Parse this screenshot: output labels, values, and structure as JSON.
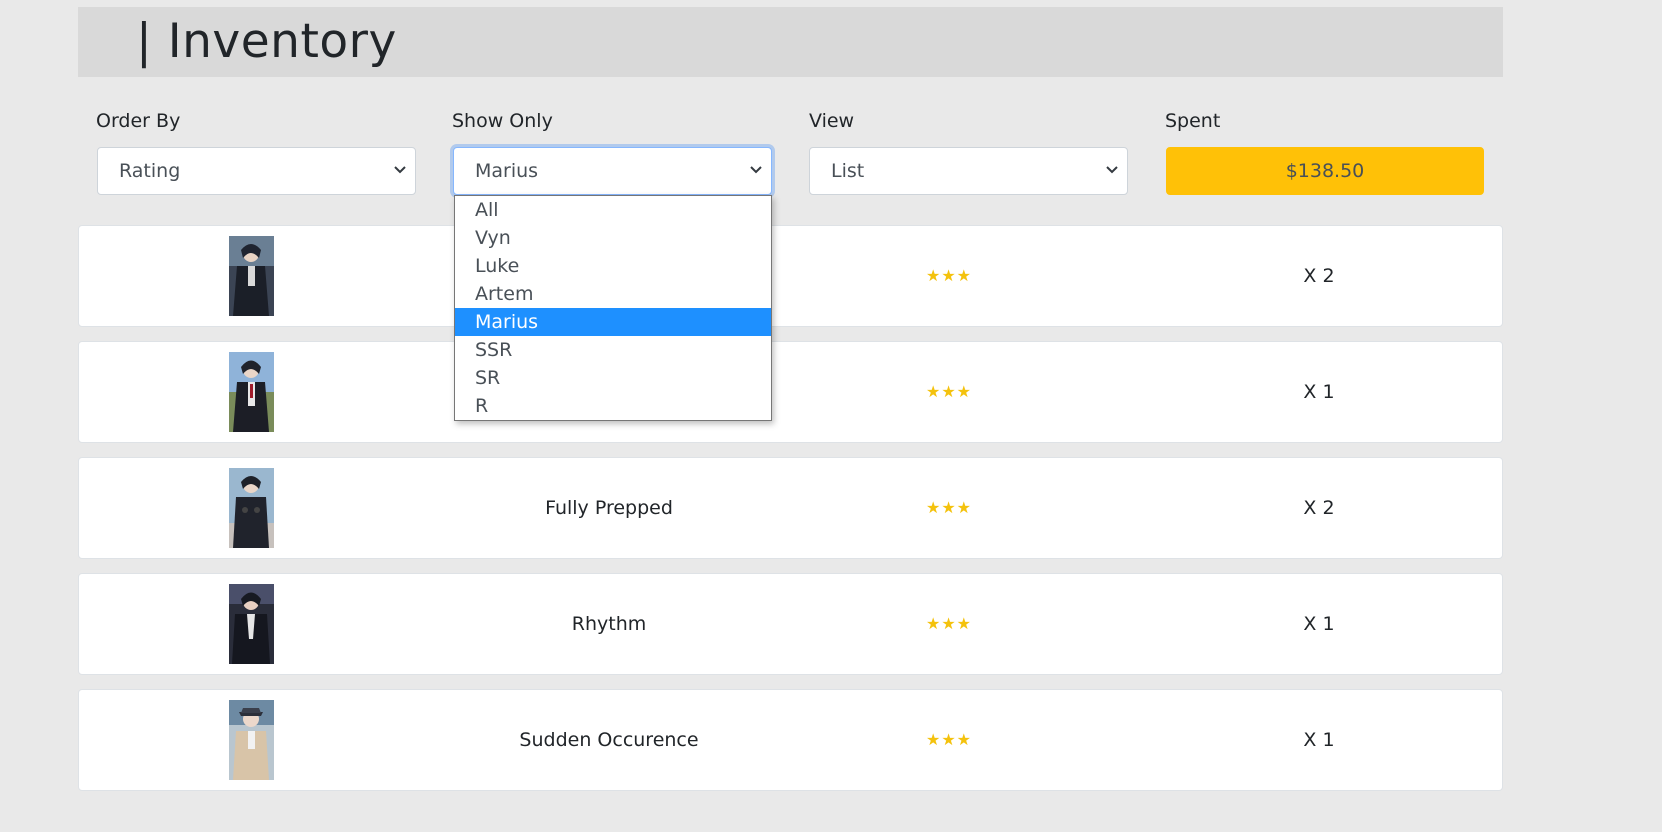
{
  "header": {
    "title": "| Inventory"
  },
  "filters": {
    "order_by": {
      "label": "Order By",
      "value": "Rating"
    },
    "show_only": {
      "label": "Show Only",
      "value": "Marius",
      "options": [
        "All",
        "Vyn",
        "Luke",
        "Artem",
        "Marius",
        "SSR",
        "SR",
        "R"
      ],
      "selected_index": 4
    },
    "view": {
      "label": "View",
      "value": "List"
    },
    "spent": {
      "label": "Spent",
      "value": "$138.50"
    }
  },
  "colors": {
    "accent_spent": "#ffc107",
    "option_highlight": "#1e90ff",
    "star": "#f4c20d"
  },
  "rows": [
    {
      "name": "",
      "stars": "★★★",
      "count": "X 2"
    },
    {
      "name": "",
      "stars": "★★★",
      "count": "X 1"
    },
    {
      "name": "Fully Prepped",
      "stars": "★★★",
      "count": "X 2"
    },
    {
      "name": "Rhythm",
      "stars": "★★★",
      "count": "X 1"
    },
    {
      "name": "Sudden Occurence",
      "stars": "★★★",
      "count": "X 1"
    }
  ]
}
